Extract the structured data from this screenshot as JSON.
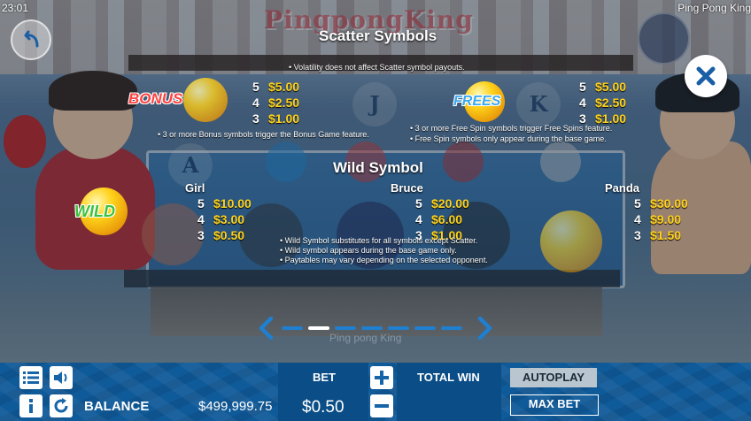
{
  "status": {
    "clock": "23:01",
    "game_title": "Ping Pong King"
  },
  "logo_text": "PingpongKing",
  "scatter": {
    "title": "Scatter Symbols",
    "volatility_note": "Volatility does not affect Scatter symbol payouts.",
    "bonus": {
      "label": "BONUS",
      "payouts": [
        {
          "count": "5",
          "amount": "$5.00"
        },
        {
          "count": "4",
          "amount": "$2.50"
        },
        {
          "count": "3",
          "amount": "$1.00"
        }
      ],
      "note": "3 or more Bonus symbols trigger the Bonus Game feature."
    },
    "frees": {
      "label": "FREES",
      "payouts": [
        {
          "count": "5",
          "amount": "$5.00"
        },
        {
          "count": "4",
          "amount": "$2.50"
        },
        {
          "count": "3",
          "amount": "$1.00"
        }
      ],
      "notes": [
        "3 or more Free Spin symbols trigger Free Spins feature.",
        "Free Spin symbols only appear during the base game."
      ]
    }
  },
  "wild": {
    "title": "Wild Symbol",
    "label": "WILD",
    "characters": [
      {
        "name": "Girl",
        "payouts": [
          {
            "count": "5",
            "amount": "$10.00"
          },
          {
            "count": "4",
            "amount": "$3.00"
          },
          {
            "count": "3",
            "amount": "$0.50"
          }
        ]
      },
      {
        "name": "Bruce",
        "payouts": [
          {
            "count": "5",
            "amount": "$20.00"
          },
          {
            "count": "4",
            "amount": "$6.00"
          },
          {
            "count": "3",
            "amount": "$1.00"
          }
        ]
      },
      {
        "name": "Panda",
        "payouts": [
          {
            "count": "5",
            "amount": "$30.00"
          },
          {
            "count": "4",
            "amount": "$9.00"
          },
          {
            "count": "3",
            "amount": "$1.50"
          }
        ]
      }
    ],
    "notes": [
      "Wild Symbol substitutes for all symbols except Scatter.",
      "Wild symbol appears during the base game only.",
      "Paytables may vary depending on the selected opponent."
    ]
  },
  "faded_letters": [
    "J",
    "K",
    "A"
  ],
  "pager": {
    "pages": 7,
    "current": 2,
    "watermark": "Ping pong King"
  },
  "bottom_bar": {
    "balance_label": "BALANCE",
    "balance_value": "$499,999.75",
    "bet_label": "BET",
    "bet_value": "$0.50",
    "total_win_label": "TOTAL WIN",
    "autoplay_label": "AUTOPLAY",
    "max_bet_label": "MAX BET"
  },
  "icons": [
    "back-arrow-icon",
    "close-icon",
    "menu-icon",
    "sound-icon",
    "info-icon",
    "refresh-icon",
    "plus-icon",
    "minus-icon",
    "chevron-left-icon",
    "chevron-right-icon"
  ],
  "colors": {
    "payout_amount": "#ffd21a",
    "bar_bg": "#0f5a99",
    "pager_dot": "#1f7fd0",
    "close_icon": "#1a5fa6"
  }
}
